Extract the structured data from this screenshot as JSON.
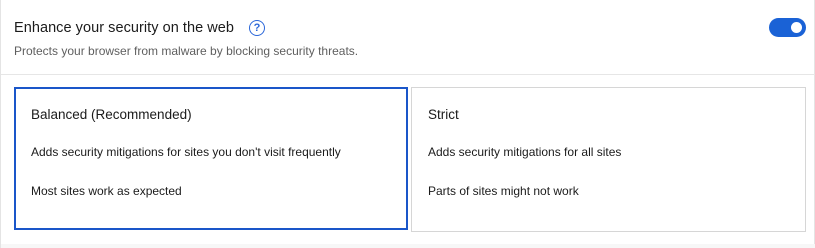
{
  "setting": {
    "title": "Enhance your security on the web",
    "subtitle": "Protects your browser from malware by blocking security threats.",
    "help_icon": "question-circle-icon",
    "help_glyph": "?",
    "toggle_enabled": true
  },
  "options": {
    "balanced": {
      "title": "Balanced (Recommended)",
      "line1": "Adds security mitigations for sites you don't visit frequently",
      "line2": "Most sites work as expected",
      "selected": true
    },
    "strict": {
      "title": "Strict",
      "line1": "Adds security mitigations for all sites",
      "line2": "Parts of sites might not work",
      "selected": false
    }
  },
  "colors": {
    "accent": "#1a62d6",
    "selected_border": "#1a56c9",
    "help_icon": "#2b67d9"
  }
}
